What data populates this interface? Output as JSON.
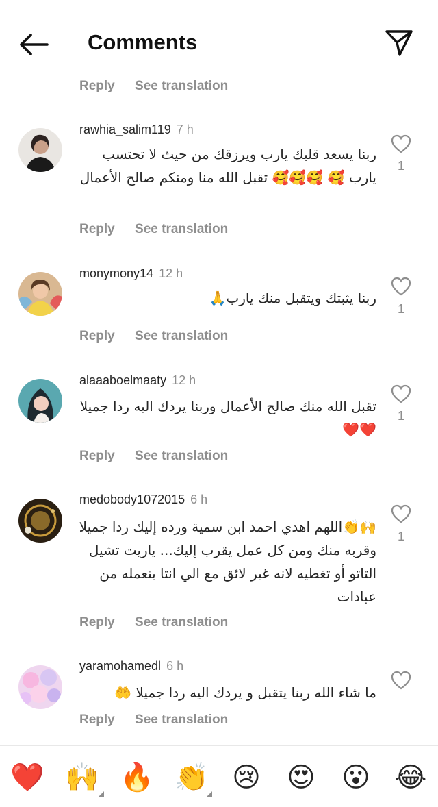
{
  "header": {
    "title": "Comments",
    "back_icon": "arrow-left-icon",
    "send_icon": "paper-plane-icon"
  },
  "actions": {
    "reply": "Reply",
    "see_translation": "See translation"
  },
  "comments": [
    {
      "username": "rawhia_salim119",
      "time": "7 h",
      "text": "ربنا يسعد قلبك يارب ويرزقك من حيث لا تحتسب يارب 🥰 🥰🥰🥰 تقبل الله منا ومنكم صالح الأعمال",
      "likes": "1"
    },
    {
      "username": "monymony14",
      "time": "12 h",
      "text": "ربنا يثبتك ويتقبل منك يارب🙏",
      "likes": "1"
    },
    {
      "username": "alaaaboelmaaty",
      "time": "12 h",
      "text": "تقبل الله منك صالح الأعمال وربنا يردك اليه ردا جميلا ❤️❤️",
      "likes": "1"
    },
    {
      "username": "medobody1072015",
      "time": "6 h",
      "text": "🙌👏اللهم اهدي احمد ابن سمية ورده إليك ردا جميلا وقربه منك ومن كل عمل يقرب إليك... ياريت تشيل التاتو أو تغطيه لانه غير لائق مع الي انتا بتعمله من عبادات",
      "likes": "1"
    },
    {
      "username": "yaramohamedl",
      "time": "6 h",
      "text": "ما شاء الله ربنا يتقبل و يردك اليه ردا جميلا 🤲",
      "likes": ""
    }
  ],
  "emoji_bar": [
    "❤️",
    "🙌",
    "🔥",
    "👏",
    "😢",
    "😍",
    "😮",
    "😂"
  ],
  "colors": {
    "text": "#262626",
    "secondary": "#8e8e8e",
    "background": "#ffffff"
  }
}
